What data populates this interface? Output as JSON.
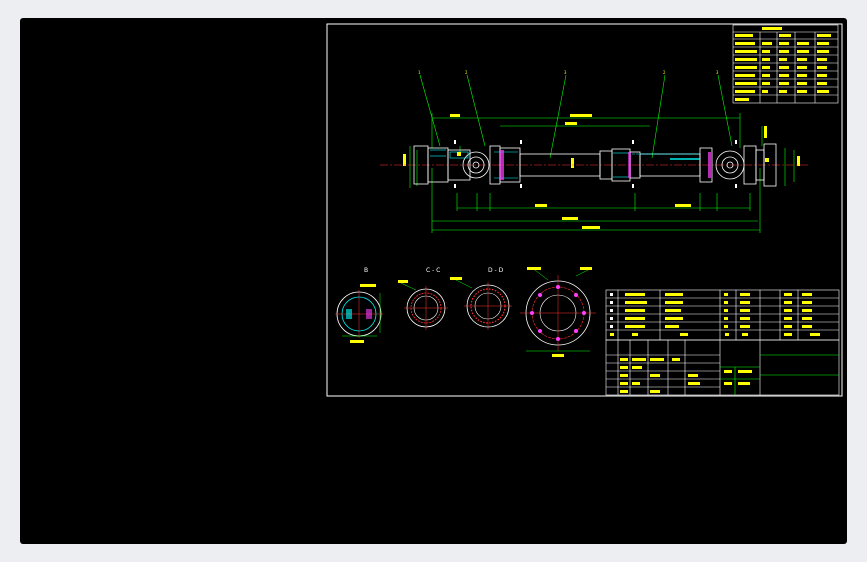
{
  "colors": {
    "background": "#000000",
    "frame": "#ffffff",
    "outline": "#ffffff",
    "dimension": "#00ff00",
    "centerline": "#ff3030",
    "hidden": "#00ffff",
    "text": "#ffff00",
    "magenta": "#ff40ff"
  },
  "drawing": {
    "section_labels": {
      "b": "B",
      "c": "C - C",
      "d": "D - D"
    }
  }
}
